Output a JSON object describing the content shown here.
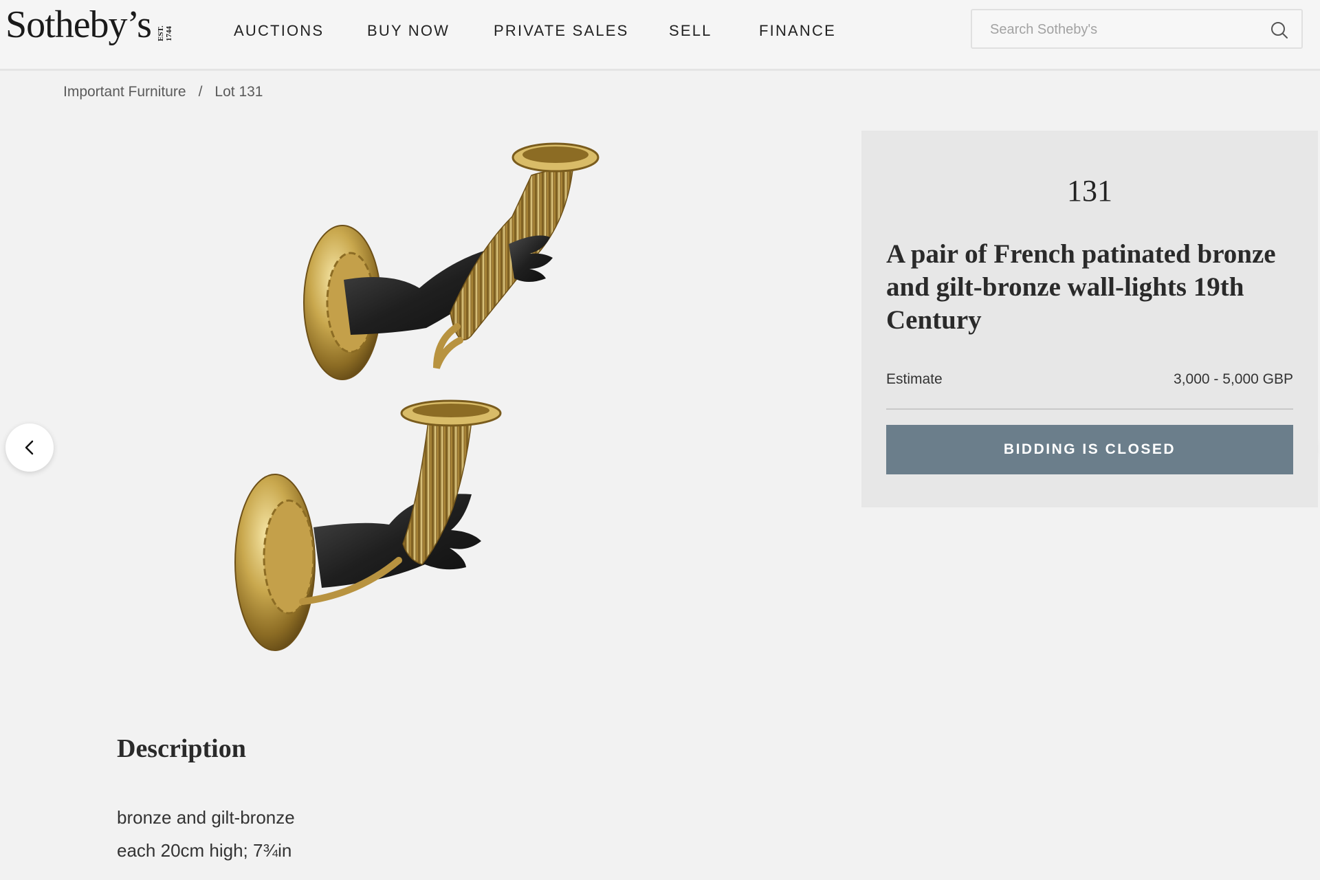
{
  "header": {
    "logo_text": "Sotheby’s",
    "logo_est": "EST. 1744",
    "nav": [
      "AUCTIONS",
      "BUY NOW",
      "PRIVATE SALES",
      "SELL",
      "FINANCE"
    ],
    "search": {
      "placeholder": "Search Sotheby's"
    }
  },
  "breadcrumb": {
    "items": [
      "Important Furniture",
      "Lot 131"
    ],
    "separator": "/"
  },
  "lot": {
    "number": "131",
    "title": "A pair of French patinated bronze and gilt-bronze wall-lights 19th Century",
    "estimate_label": "Estimate",
    "estimate_value": "3,000 - 5,000 GBP",
    "bid_button": "BIDDING IS CLOSED"
  },
  "description": {
    "heading": "Description",
    "lines": [
      "bronze and gilt-bronze",
      "each 20cm high; 7¾in"
    ]
  },
  "icons": {
    "search": "search-icon",
    "prev": "chevron-left-icon",
    "next": "chevron-right-icon"
  },
  "colors": {
    "bid_button": "#6b7e8b",
    "panel": "#e7e7e7",
    "page": "#f2f2f2"
  }
}
